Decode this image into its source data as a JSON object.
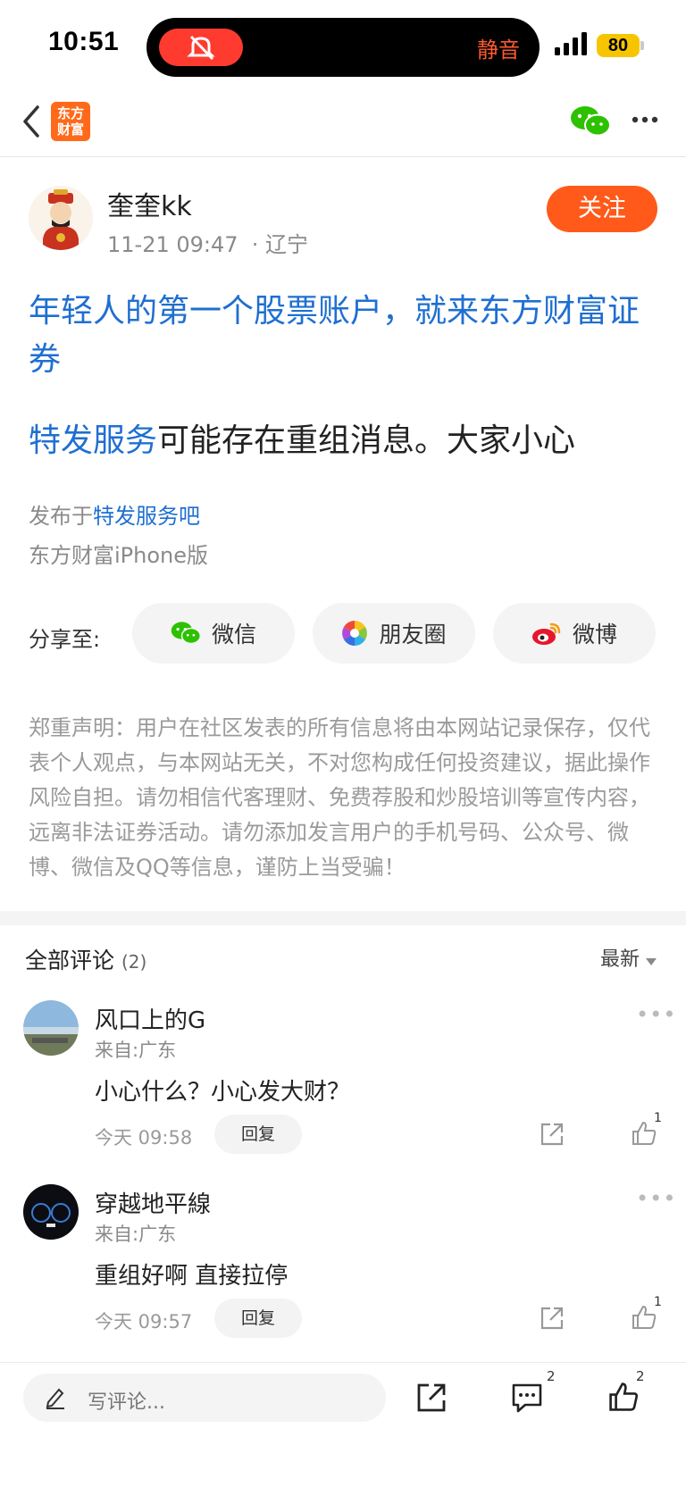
{
  "status_bar": {
    "time": "10:51",
    "mute_text": "静音",
    "battery": "80"
  },
  "nav": {
    "logo_text": "东方财富"
  },
  "post": {
    "author": "奎奎kk",
    "date": "11-21 09:47",
    "location": "· 辽宁",
    "follow_label": "关注",
    "headline": "年轻人的第一个股票账户，就来东方财富证券",
    "stock_tag": "特发服务",
    "body": "可能存在重组消息。大家小心",
    "published_prefix": "发布于",
    "published_bar": "特发服务吧",
    "client": "东方财富iPhone版"
  },
  "share": {
    "label": "分享至:",
    "wechat": "微信",
    "moments": "朋友圈",
    "weibo": "微博"
  },
  "disclaimer": "郑重声明：用户在社区发表的所有信息将由本网站记录保存，仅代表个人观点，与本网站无关，不对您构成任何投资建议，据此操作风险自担。请勿相信代客理财、免费荐股和炒股培训等宣传内容，远离非法证券活动。请勿添加发言用户的手机号码、公众号、微博、微信及QQ等信息，谨防上当受骗！",
  "comments": {
    "title": "全部评论",
    "count": "(2)",
    "sort": "最新",
    "items": [
      {
        "name": "风口上的G",
        "location": "来自:广东",
        "text": "小心什么？小心发大财？",
        "time": "今天 09:58",
        "reply": "回复",
        "likes": "1"
      },
      {
        "name": "穿越地平線",
        "location": "来自:广东",
        "text": "重组好啊  直接拉停",
        "time": "今天 09:57",
        "reply": "回复",
        "likes": "1"
      }
    ]
  },
  "bottom_bar": {
    "placeholder": "写评论...",
    "comment_count": "2",
    "like_count": "2"
  },
  "colors": {
    "accent_orange": "#ff5a1a",
    "link_blue": "#1f6fd1",
    "wechat_green": "#2dc100"
  }
}
